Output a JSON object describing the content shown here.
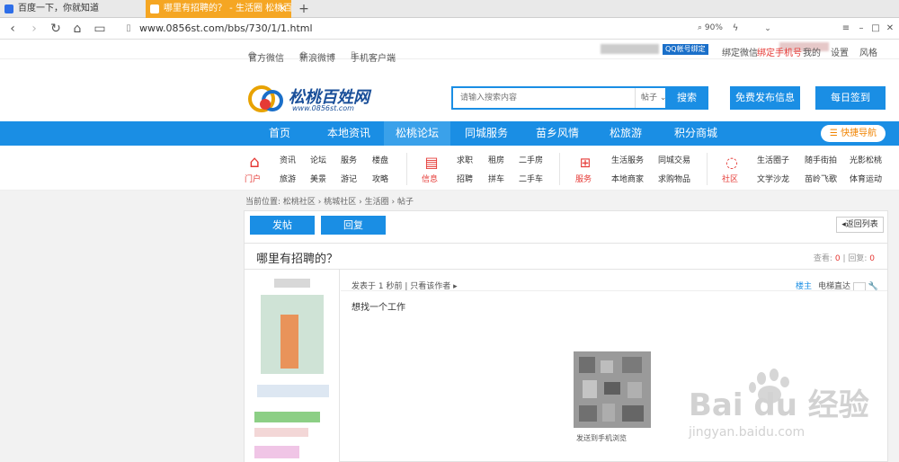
{
  "browser": {
    "tabs": [
      {
        "label": "百度一下，你就知道"
      },
      {
        "label": "哪里有招聘的？ - 生活圈 松桃百姓网"
      }
    ],
    "new_tab": "+",
    "url": "www.0856st.com/bbs/730/1/1.html",
    "zoom": "90%"
  },
  "topstrip": {
    "wechat": "官方微信",
    "weibo": "新浪微博",
    "app": "手机客户端",
    "qq_badge": "QQ帐号绑定",
    "bind_wechat": "绑定微信",
    "bind_phone": "绑定手机号",
    "mine": "我的",
    "settings": "设置",
    "style": "风格"
  },
  "header": {
    "logo_text": "松桃百姓网",
    "logo_url": "www.0856st.com",
    "search_placeholder": "请输入搜索内容",
    "search_select": "帖子",
    "search_btn": "搜索",
    "free_post": "免费发布信息",
    "checkin": "每日签到"
  },
  "mainnav": {
    "items": [
      "首页",
      "本地资讯",
      "松桃论坛",
      "同城服务",
      "苗乡风情",
      "松旅游",
      "积分商城"
    ],
    "quick": "快捷导航"
  },
  "subnav": {
    "groups": [
      {
        "label": "门户",
        "links": [
          "资讯",
          "论坛",
          "服务",
          "楼盘",
          "旅游",
          "美景",
          "游记",
          "攻略"
        ]
      },
      {
        "label": "信息",
        "links": [
          "求职",
          "租房",
          "二手房",
          "招聘",
          "拼车",
          "二手车"
        ]
      },
      {
        "label": "服务",
        "links": [
          "生活服务",
          "同城交易",
          "本地商家",
          "求购物品"
        ]
      },
      {
        "label": "社区",
        "links": [
          "生活圈子",
          "随手街拍",
          "光影松桃",
          "文学沙龙",
          "苗岭飞歌",
          "体育运动"
        ]
      }
    ]
  },
  "content": {
    "breadcrumb": [
      "当前位置:",
      "松桃社区",
      "桃城社区",
      "生活圈",
      "帖子"
    ],
    "post_btn": "发帖",
    "reply_btn": "回复",
    "back_list": "返回列表",
    "title": "哪里有招聘的？",
    "views_label": "查看:",
    "views": "0",
    "replies_label": "回复:",
    "replies": "0",
    "posted": "发表于 1 秒前",
    "only_author": "只看该作者",
    "floor": "楼主",
    "elevator": "电梯直达",
    "body": "想找一个工作",
    "qr_caption": "发送到手机浏览"
  },
  "watermark": {
    "text": "Bai du 经验",
    "sub": "jingyan.baidu.com"
  }
}
